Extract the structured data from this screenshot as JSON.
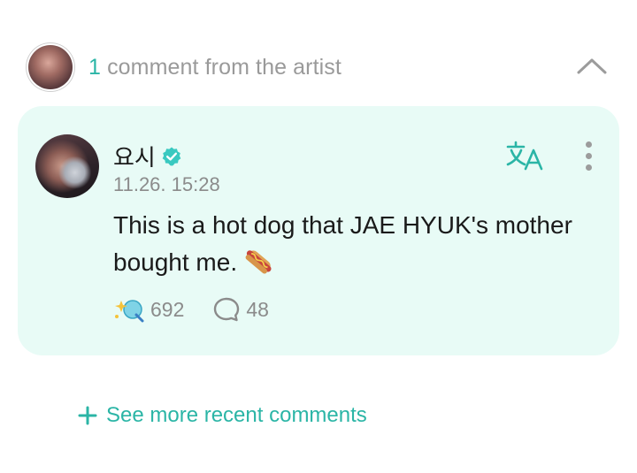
{
  "header": {
    "count": "1",
    "label": "comment from the artist",
    "collapse_icon": "chevron-up-icon"
  },
  "comment": {
    "author": "요시",
    "verified_icon": "verified-badge-icon",
    "timestamp": "11.26. 15:28",
    "body": "This is a hot dog that JAE HYUK's mother bought me.",
    "body_emoji_icon": "hot-dog-icon",
    "translate_icon": "translate-icon",
    "more_icon": "more-vertical-icon",
    "reaction_count": "692",
    "reply_count": "48"
  },
  "footer": {
    "see_more_label": "See more recent comments",
    "see_more_icon": "plus-icon"
  },
  "colors": {
    "accent": "#2bb5a6",
    "card_bg": "#e8fbf6",
    "muted_text": "#8b8b8b",
    "verified": "#39c9c0"
  }
}
